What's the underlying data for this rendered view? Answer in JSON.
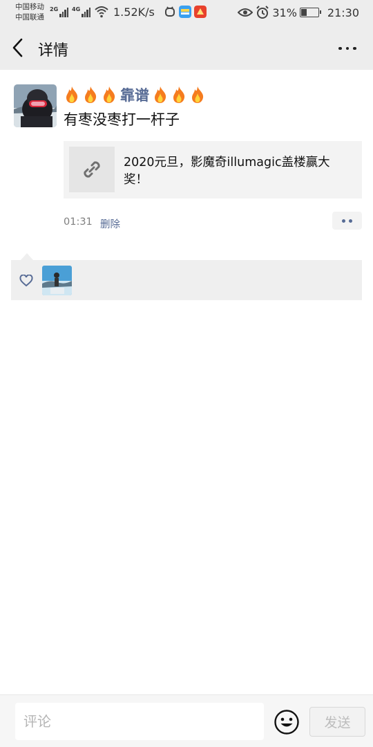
{
  "status_bar": {
    "carrier_1": "中国移动",
    "carrier_2": "中国联通",
    "network_1": "2G",
    "network_2": "4G",
    "speed": "1.52K/s",
    "battery": "31%",
    "battery_level": 0.31,
    "time": "21:30"
  },
  "nav": {
    "title": "详情"
  },
  "post": {
    "username": "靠谱",
    "text": "有枣没枣打一杆子",
    "link_title": "2020元旦，影魔奇illumagic盖楼赢大奖！",
    "time": "01:31",
    "delete_label": "删除"
  },
  "comment": {
    "placeholder": "评论",
    "send_label": "发送"
  },
  "colors": {
    "link_blue": "#576b95",
    "bar_gray": "#ededed"
  }
}
